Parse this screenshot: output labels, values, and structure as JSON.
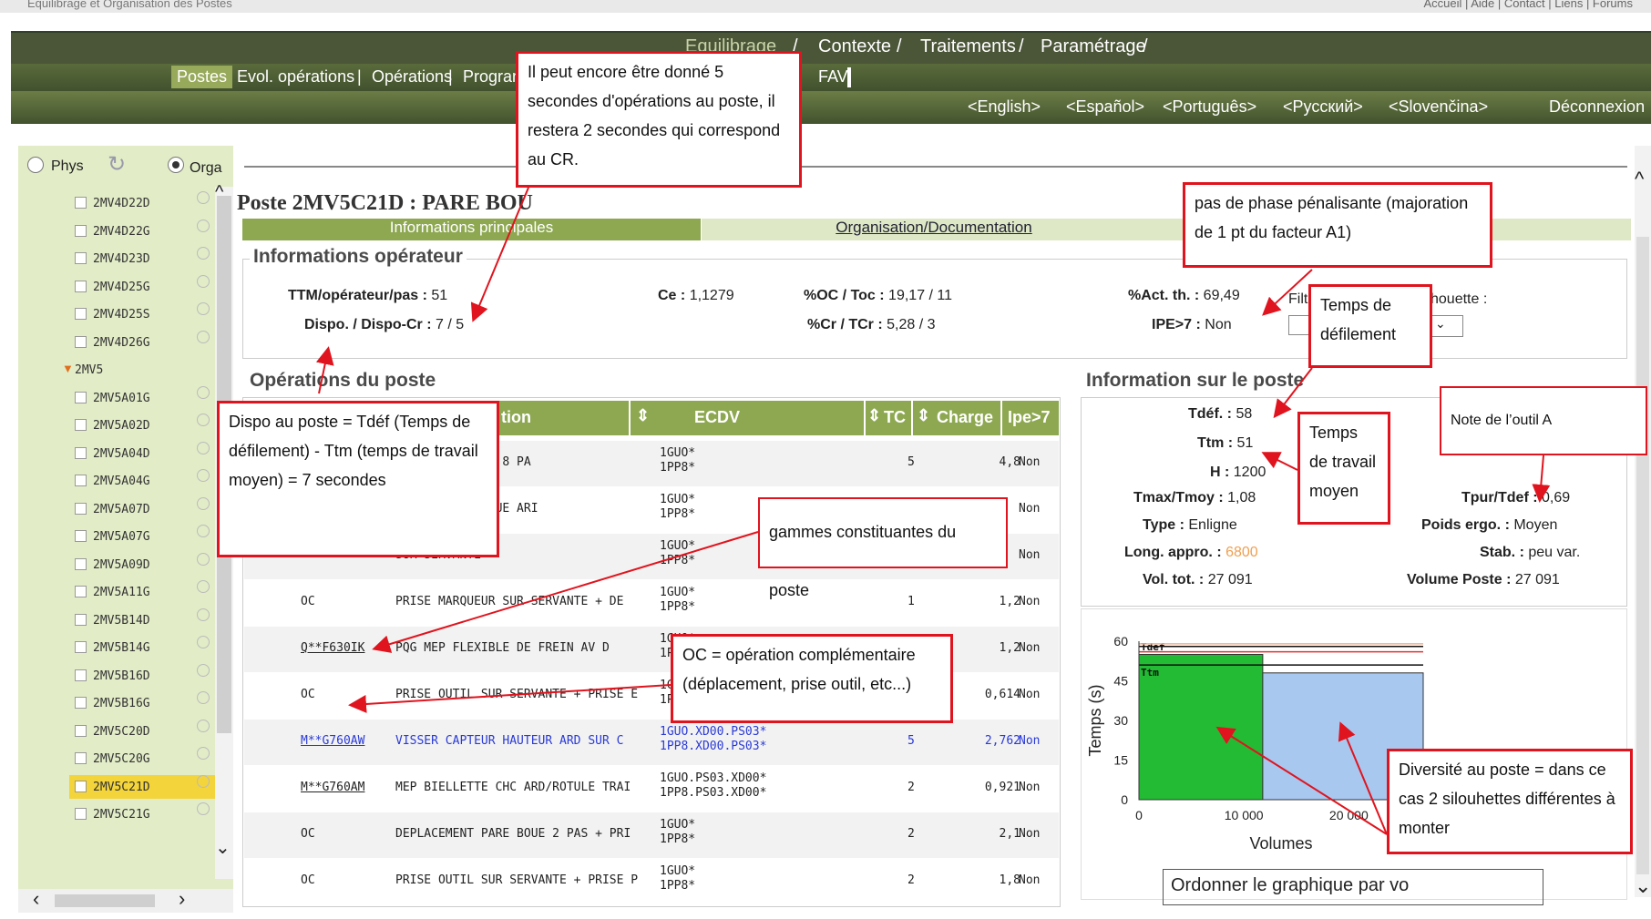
{
  "top": {
    "title": "Equilibrage et Organisation des Postes",
    "links": "Accueil | Aide | Contact | Liens | Forums"
  },
  "nav": {
    "main_tabs": [
      "Equilibrage",
      "Contexte",
      "Traitements",
      "Paramétrage"
    ],
    "sub_tabs": [
      "Postes",
      "Evol. opérations",
      "Opérations",
      "Programm",
      "FAV"
    ],
    "languages": [
      "<English>",
      "<Español>",
      "<Português>",
      "<Русский>",
      "<Slovenčina>"
    ],
    "logout": "Déconnexion"
  },
  "sidebar": {
    "radio_phys": "Phys",
    "radio_orga": "Orga",
    "group": "2MV5",
    "items_top": [
      "2MV4D22D",
      "2MV4D22G",
      "2MV4D23D",
      "2MV4D25G",
      "2MV4D25S",
      "2MV4D26G"
    ],
    "items": [
      "2MV5A01G",
      "2MV5A02D",
      "2MV5A04D",
      "2MV5A04G",
      "2MV5A07D",
      "2MV5A07G",
      "2MV5A09D",
      "2MV5A11G",
      "2MV5B14D",
      "2MV5B14G",
      "2MV5B16D",
      "2MV5B16G",
      "2MV5C20D",
      "2MV5C20G",
      "2MV5C21D",
      "2MV5C21G"
    ],
    "selected": "2MV5C21D"
  },
  "poste": {
    "title": "Poste 2MV5C21D : PARE BOU",
    "tabs": [
      "Informations principales",
      "Organisation/Documentation"
    ]
  },
  "operateur": {
    "section": "Informations opérateur",
    "ttm_label": "TTM/opérateur/pas :",
    "ttm_value": "51",
    "dispo_label": "Dispo. / Dispo-Cr :",
    "dispo_value": "7 / 5",
    "ce_label": "Ce :",
    "ce_value": "1,1279",
    "oc_label": "%OC / Toc :",
    "oc_value": "19,17 / 11",
    "cr_label": "%Cr / TCr :",
    "cr_value": "5,28 / 3",
    "act_label": "%Act. th. :",
    "act_value": "69,49",
    "ipe_label": "IPE>7 :",
    "ipe_value": "Non",
    "filter_label": "Filt",
    "silhouette_label": "houette :"
  },
  "operations": {
    "section": "Opérations du poste",
    "headers": [
      "tion",
      "ECDV",
      "TC",
      "Charge",
      "Ipe>7"
    ],
    "rows": [
      {
        "code": "",
        "desc": "HICULE SUIVANT 8 PA",
        "ecdv1": "1GUO*",
        "ecdv2": "1PP8*",
        "tc": "5",
        "charge": "4,8",
        "ipe": "Non",
        "blue": false
      },
      {
        "code": "",
        "desc": "TS FIX PARE BOUE ARI",
        "ecdv1": "1GUO*",
        "ecdv2": "1PP8*",
        "tc": "",
        "charge": "",
        "ipe": "Non",
        "blue": false
      },
      {
        "code": "",
        "desc": "SUR SERVANTE",
        "ecdv1": "1GUO*",
        "ecdv2": "1PP8*",
        "tc": "",
        "charge": "",
        "ipe": "Non",
        "blue": false
      },
      {
        "code": "OC",
        "desc": "PRISE MARQUEUR SUR SERVANTE + DE",
        "ecdv1": "1GUO*",
        "ecdv2": "1PP8*",
        "tc": "1",
        "charge": "1,2",
        "ipe": "Non",
        "blue": false
      },
      {
        "code": "Q**F630IK",
        "desc": "PQG MEP FLEXIBLE DE FREIN AV D",
        "ecdv1": "1GUO*",
        "ecdv2": "1PP8*",
        "tc": "",
        "charge": "1,2",
        "ipe": "Non",
        "blue": false
      },
      {
        "code": "OC",
        "desc": "PRISE OUTIL SUR SERVANTE + PRISE E",
        "ecdv1": "1GUO.",
        "ecdv2": "1PP8.X",
        "tc": "",
        "charge": "0,614",
        "ipe": "Non",
        "blue": false
      },
      {
        "code": "M**G760AW",
        "desc": "VISSER CAPTEUR HAUTEUR ARD SUR C",
        "ecdv1": "1GUO.XD00.PS03*",
        "ecdv2": "1PP8.XD00.PS03*",
        "tc": "5",
        "charge": "2,762",
        "ipe": "Non",
        "blue": true
      },
      {
        "code": "M**G760AM",
        "desc": "MEP BIELLETTE CHC ARD/ROTULE TRAI",
        "ecdv1": "1GUO.PS03.XD00*",
        "ecdv2": "1PP8.PS03.XD00*",
        "tc": "2",
        "charge": "0,921",
        "ipe": "Non",
        "blue": false
      },
      {
        "code": "OC",
        "desc": "DEPLACEMENT PARE BOUE 2 PAS + PRI",
        "ecdv1": "1GUO*",
        "ecdv2": "1PP8*",
        "tc": "2",
        "charge": "2,1",
        "ipe": "Non",
        "blue": false
      },
      {
        "code": "OC",
        "desc": "PRISE OUTIL SUR SERVANTE + PRISE P",
        "ecdv1": "1GUO*",
        "ecdv2": "1PP8*",
        "tc": "2",
        "charge": "1,8",
        "ipe": "Non",
        "blue": false
      }
    ]
  },
  "poste_info": {
    "section": "Information sur le poste",
    "tdef_label": "Tdéf. :",
    "tdef_value": "58",
    "ttm_label": "Ttm :",
    "ttm_value": "51",
    "h_label": "H :",
    "h_value": "1200",
    "tmax_label": "Tmax/Tmoy :",
    "tmax_value": "1,08",
    "type_label": "Type :",
    "type_value": "Enligne",
    "long_label": "Long. appro. :",
    "long_value": "6800",
    "vol_label": "Vol. tot. :",
    "vol_value": "27 091",
    "tpur_label": "Tpur/Tdef :",
    "tpur_value": "0,69",
    "poids_label": "Poids ergo. :",
    "poids_value": "Moyen",
    "stab_label": "Stab. :",
    "stab_value": "peu var.",
    "volposte_label": "Volume Poste :",
    "volposte_value": "27 091"
  },
  "chart_data": {
    "type": "bar",
    "ylabel": "Temps (s)",
    "xlabel": "Volumes",
    "xticks": [
      "0",
      "10 000",
      "20 000"
    ],
    "yticks": [
      "0",
      "15",
      "30",
      "45",
      "60"
    ],
    "xlim": [
      0,
      27091
    ],
    "ylim": [
      0,
      60
    ],
    "bars": [
      {
        "x0": 0,
        "x1": 11800,
        "value": 55,
        "color": "#22bb33"
      },
      {
        "x0": 11800,
        "x1": 27091,
        "value": 48,
        "color": "#a8c8f0"
      }
    ],
    "lines": [
      {
        "name": "Tdef",
        "value": 58,
        "color": "#111111"
      },
      {
        "name": "Ttm",
        "value": 51,
        "color": "#111111"
      },
      {
        "name": "",
        "value": 56,
        "color": "#e53333"
      },
      {
        "name": "",
        "value": 59,
        "color": "#f0b090"
      }
    ]
  },
  "chart_button": "Ordonner le graphique par vo",
  "notes": {
    "n1": "Il peut encore être donné 5 secondes d'opérations au poste, il restera 2 secondes qui correspond au CR.",
    "n2": "pas de phase pénalisante (majoration de 1 pt du facteur A1)",
    "n3": "Temps de défilement",
    "n4": "Note de l’outil A",
    "n5": "Dispo au poste = Tdéf (Temps de défilement) - Ttm (temps de travail moyen) = 7 secondes",
    "n6": "gammes constituantes du poste",
    "n7": "Temps de travail moyen",
    "n8": "OC = opération complémentaire (déplacement, prise outil, etc...)",
    "n9": "Diversité au poste = dans ce cas 2 silouhettes différentes à monter"
  }
}
